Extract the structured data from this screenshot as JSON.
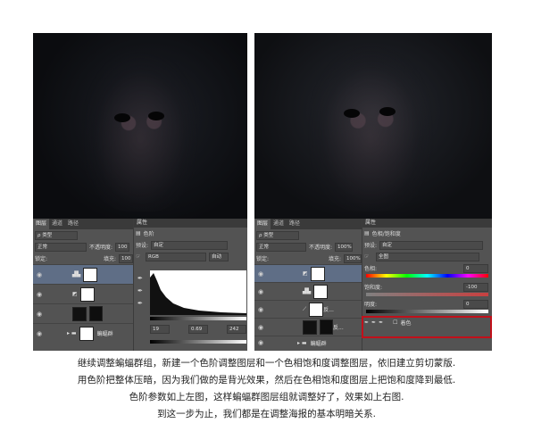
{
  "left": {
    "tabs": [
      "图层",
      "通道",
      "路径"
    ],
    "kind_label": "ρ 类型",
    "blend_mode": "正常",
    "opacity_label": "不透明度:",
    "opacity_value": "100",
    "lock_label": "锁定:",
    "fill_label": "填充:",
    "fill_value": "100",
    "layers": [
      "",
      "",
      "",
      "蝙蝠群"
    ],
    "props_tab": "属性",
    "props_title": "色阶",
    "preset_label": "预设:",
    "preset_value": "自定",
    "channel_value": "RGB",
    "auto_label": "自动",
    "input_values": [
      "19",
      "0.69",
      "242"
    ]
  },
  "right": {
    "tabs": [
      "图层",
      "通道",
      "路径"
    ],
    "kind_label": "ρ 类型",
    "blend_mode": "正常",
    "opacity_label": "不透明度:",
    "opacity_value": "100%",
    "lock_label": "锁定:",
    "fill_label": "填充:",
    "fill_value": "100%",
    "layers": [
      "",
      "",
      "反...",
      "反...",
      "蝙蝠群"
    ],
    "props_tab": "属性",
    "props_title": "色相/饱和度",
    "preset_label": "预设:",
    "preset_value": "自定",
    "channel_value": "全图",
    "hue_label": "色相:",
    "hue_value": "0",
    "sat_label": "饱和度:",
    "sat_value": "-100",
    "light_label": "明度:",
    "light_value": "0",
    "colorize_label": "着色"
  },
  "caption": [
    "继续调整蝙蝠群组，新建一个色阶调整图层和一个色相饱和度调整图层，依旧建立剪切蒙版.",
    "用色阶把整体压暗，因为我们做的是背光效果，然后在色相饱和度图层上把饱和度降到最低.",
    "色阶参数如上左图，这样蝙蝠群图层组就调整好了，效果如上右图.",
    "到这一步为止，我们都是在调整海报的基本明暗关系."
  ],
  "colors": {
    "panel": "#535353",
    "highlight_box": "#c1101a",
    "selected_layer": "#5f6e86"
  }
}
